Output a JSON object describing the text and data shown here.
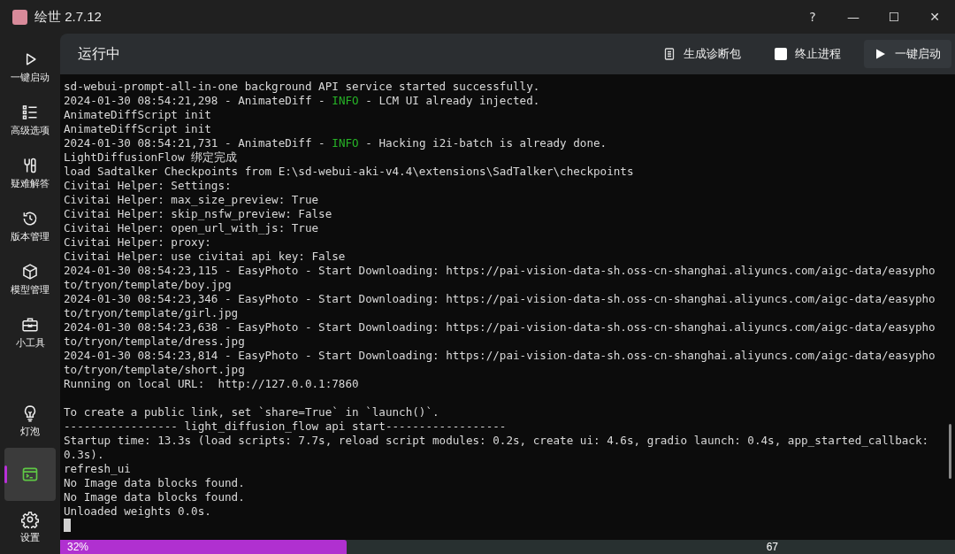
{
  "window": {
    "title": "绘世 2.7.12",
    "controls": [
      "?",
      "—",
      "☐",
      "✕"
    ]
  },
  "sidebar": {
    "items": [
      {
        "label": "一键启动",
        "selected": false
      },
      {
        "label": "高级选项",
        "selected": false
      },
      {
        "label": "疑难解答",
        "selected": false
      },
      {
        "label": "版本管理",
        "selected": false
      },
      {
        "label": "模型管理",
        "selected": false
      },
      {
        "label": "小工具",
        "selected": false
      }
    ],
    "bottom_items": [
      {
        "label": "灯泡",
        "selected": false
      },
      {
        "selected": true
      },
      {
        "label": "设置",
        "selected": false
      }
    ]
  },
  "header": {
    "title": "运行中",
    "diagnose_button": "生成诊断包",
    "stop_checkbox": {
      "label": "终止进程",
      "checked": false
    },
    "launch_button": "一键启动"
  },
  "console": {
    "lines": [
      {
        "kind": "text",
        "segments": [
          {
            "kind": "plain",
            "text": "sd-webui-prompt-all-in-one background API service started successfully."
          }
        ]
      },
      {
        "kind": "text",
        "segments": [
          {
            "kind": "plain",
            "text": "2024-01-30 08:54:21,298 - AnimateDiff - "
          },
          {
            "kind": "info",
            "text": "INFO"
          },
          {
            "kind": "plain",
            "text": " - LCM UI already injected."
          }
        ]
      },
      {
        "kind": "text",
        "segments": [
          {
            "kind": "plain",
            "text": "AnimateDiffScript init"
          }
        ]
      },
      {
        "kind": "text",
        "segments": [
          {
            "kind": "plain",
            "text": "AnimateDiffScript init"
          }
        ]
      },
      {
        "kind": "text",
        "segments": [
          {
            "kind": "plain",
            "text": "2024-01-30 08:54:21,731 - AnimateDiff - "
          },
          {
            "kind": "info",
            "text": "INFO"
          },
          {
            "kind": "plain",
            "text": " - Hacking i2i-batch is already done."
          }
        ]
      },
      {
        "kind": "text",
        "segments": [
          {
            "kind": "plain",
            "text": "LightDiffusionFlow 绑定完成"
          }
        ]
      },
      {
        "kind": "text",
        "segments": [
          {
            "kind": "plain",
            "text": "load Sadtalker Checkpoints from E:\\sd-webui-aki-v4.4\\extensions\\SadTalker\\checkpoints"
          }
        ]
      },
      {
        "kind": "text",
        "segments": [
          {
            "kind": "plain",
            "text": "Civitai Helper: Settings:"
          }
        ]
      },
      {
        "kind": "text",
        "segments": [
          {
            "kind": "plain",
            "text": "Civitai Helper: max_size_preview: True"
          }
        ]
      },
      {
        "kind": "text",
        "segments": [
          {
            "kind": "plain",
            "text": "Civitai Helper: skip_nsfw_preview: False"
          }
        ]
      },
      {
        "kind": "text",
        "segments": [
          {
            "kind": "plain",
            "text": "Civitai Helper: open_url_with_js: True"
          }
        ]
      },
      {
        "kind": "text",
        "segments": [
          {
            "kind": "plain",
            "text": "Civitai Helper: proxy:"
          }
        ]
      },
      {
        "kind": "text",
        "segments": [
          {
            "kind": "plain",
            "text": "Civitai Helper: use civitai api key: False"
          }
        ]
      },
      {
        "kind": "text",
        "segments": [
          {
            "kind": "plain",
            "text": "2024-01-30 08:54:23,115 - EasyPhoto - Start Downloading: https://pai-vision-data-sh.oss-cn-shanghai.aliyuncs.com/aigc-data/easypho"
          }
        ]
      },
      {
        "kind": "text",
        "segments": [
          {
            "kind": "plain",
            "text": "to/tryon/template/boy.jpg"
          }
        ]
      },
      {
        "kind": "text",
        "segments": [
          {
            "kind": "plain",
            "text": "2024-01-30 08:54:23,346 - EasyPhoto - Start Downloading: https://pai-vision-data-sh.oss-cn-shanghai.aliyuncs.com/aigc-data/easypho"
          }
        ]
      },
      {
        "kind": "text",
        "segments": [
          {
            "kind": "plain",
            "text": "to/tryon/template/girl.jpg"
          }
        ]
      },
      {
        "kind": "text",
        "segments": [
          {
            "kind": "plain",
            "text": "2024-01-30 08:54:23,638 - EasyPhoto - Start Downloading: https://pai-vision-data-sh.oss-cn-shanghai.aliyuncs.com/aigc-data/easypho"
          }
        ]
      },
      {
        "kind": "text",
        "segments": [
          {
            "kind": "plain",
            "text": "to/tryon/template/dress.jpg"
          }
        ]
      },
      {
        "kind": "text",
        "segments": [
          {
            "kind": "plain",
            "text": "2024-01-30 08:54:23,814 - EasyPhoto - Start Downloading: https://pai-vision-data-sh.oss-cn-shanghai.aliyuncs.com/aigc-data/easypho"
          }
        ]
      },
      {
        "kind": "text",
        "segments": [
          {
            "kind": "plain",
            "text": "to/tryon/template/short.jpg"
          }
        ]
      },
      {
        "kind": "text",
        "segments": [
          {
            "kind": "plain",
            "text": "Running on local URL:  http://127.0.0.1:7860"
          }
        ]
      },
      {
        "kind": "blank"
      },
      {
        "kind": "text",
        "segments": [
          {
            "kind": "plain",
            "text": "To create a public link, set `share=True` in `launch()`."
          }
        ]
      },
      {
        "kind": "text",
        "segments": [
          {
            "kind": "plain",
            "text": "----------------- light_diffusion_flow api start------------------"
          }
        ]
      },
      {
        "kind": "text",
        "segments": [
          {
            "kind": "plain",
            "text": "Startup time: 13.3s (load scripts: 7.7s, reload script modules: 0.2s, create ui: 4.6s, gradio launch: 0.4s, app_started_callback:"
          }
        ]
      },
      {
        "kind": "text",
        "segments": [
          {
            "kind": "plain",
            "text": "0.3s)."
          }
        ]
      },
      {
        "kind": "text",
        "segments": [
          {
            "kind": "plain",
            "text": "refresh_ui"
          }
        ]
      },
      {
        "kind": "text",
        "segments": [
          {
            "kind": "plain",
            "text": "No Image data blocks found."
          }
        ]
      },
      {
        "kind": "text",
        "segments": [
          {
            "kind": "plain",
            "text": "No Image data blocks found."
          }
        ]
      },
      {
        "kind": "text",
        "segments": [
          {
            "kind": "plain",
            "text": "Unloaded weights 0.0s."
          }
        ]
      }
    ]
  },
  "status_bar": {
    "progress": {
      "level": 0.32,
      "label": "32%"
    },
    "right_text": "67"
  }
}
